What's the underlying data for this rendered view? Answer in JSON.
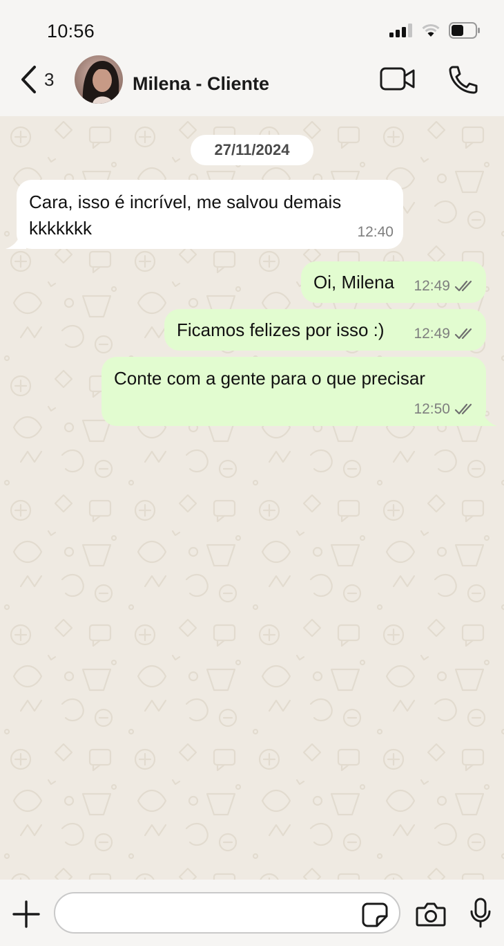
{
  "status_bar": {
    "time": "10:56",
    "icons": [
      "cellular-signal-icon",
      "wifi-icon",
      "battery-icon"
    ]
  },
  "header": {
    "back_count": "3",
    "contact_name": "Milena - Cliente",
    "icons": [
      "chevron-left-icon",
      "video-camera-icon",
      "phone-icon"
    ]
  },
  "chat": {
    "date_chip": "27/11/2024",
    "messages": [
      {
        "direction": "incoming",
        "text_lines": [
          "Cara, isso é incrível, me salvou demais",
          "kkkkkkk"
        ],
        "time": "12:40",
        "read": false
      },
      {
        "direction": "outgoing",
        "text": "Oi, Milena",
        "time": "12:49",
        "read": true
      },
      {
        "direction": "outgoing",
        "text": "Ficamos felizes por isso :)",
        "time": "12:49",
        "read": true
      },
      {
        "direction": "outgoing",
        "text": "Conte com a gente para o que precisar",
        "time": "12:50",
        "read": true
      }
    ]
  },
  "input_bar": {
    "message_value": "",
    "icons": [
      "plus-icon",
      "sticker-icon",
      "camera-icon",
      "microphone-icon"
    ]
  },
  "colors": {
    "chat_background": "#efeae2",
    "incoming_bubble": "#ffffff",
    "outgoing_bubble": "#e2fcd0",
    "bar_background": "#f6f5f3",
    "read_ticks": "#6f6f6f"
  }
}
